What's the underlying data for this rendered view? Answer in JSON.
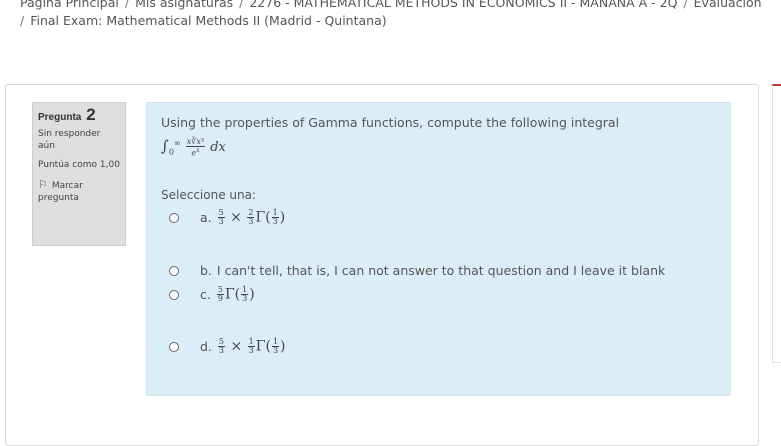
{
  "breadcrumb": {
    "items": [
      "Página Principal",
      "Mis asignaturas",
      "2276 - MATHEMATICAL METHODS IN ECONOMICS II - MAÑANA A - 2Q",
      "Evaluación"
    ],
    "current": "Final Exam: Mathematical Methods II (Madrid - Quintana)"
  },
  "question": {
    "label": "Pregunta",
    "number": "2",
    "state": "Sin responder aún",
    "grade": "Puntúa como 1,00",
    "flag_label": "Marcar pregunta",
    "text": "Using the properties of Gamma functions, compute the following integral",
    "prompt": "Seleccione una:",
    "options": [
      {
        "letter": "a."
      },
      {
        "letter": "b.",
        "text": "I can't tell, that is, I can not answer to that question and I leave it blank"
      },
      {
        "letter": "c."
      },
      {
        "letter": "d."
      }
    ]
  },
  "colors": {
    "formulation_bg": "#dbeef7",
    "info_bg": "#dedede",
    "accent": "#c0392b"
  }
}
